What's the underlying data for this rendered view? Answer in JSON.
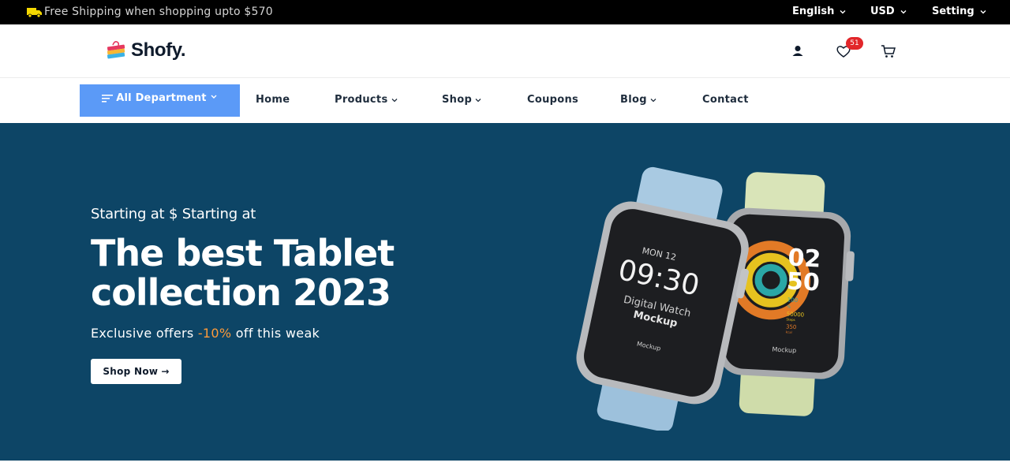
{
  "topbar": {
    "shipping_text": "Free Shipping when shopping upto $570",
    "language": "English",
    "currency": "USD",
    "setting": "Setting"
  },
  "header": {
    "logo_text": "Shofy.",
    "wishlist_count": "51"
  },
  "nav": {
    "department_label": "All Department",
    "links": [
      {
        "label": "Home",
        "has_dropdown": false
      },
      {
        "label": "Products",
        "has_dropdown": true
      },
      {
        "label": "Shop",
        "has_dropdown": true
      },
      {
        "label": "Coupons",
        "has_dropdown": false
      },
      {
        "label": "Blog",
        "has_dropdown": true
      },
      {
        "label": "Contact",
        "has_dropdown": false
      }
    ]
  },
  "hero": {
    "eyebrow": "Starting at $ Starting at",
    "headline_line1": "The best Tablet",
    "headline_line2": "collection 2023",
    "sub_before": "Exclusive offers ",
    "sub_highlight": "-10%",
    "sub_after": " off this weak",
    "cta_label": "Shop Now",
    "cta_arrow": "→",
    "watch1": {
      "date": "MON 12",
      "time": "09:30",
      "line1": "Digital Watch",
      "line2": "Mockup",
      "brand": "Mockup"
    },
    "watch2": {
      "hour": "02",
      "minute": "50",
      "stat1": "100",
      "stat2": "%",
      "stat3": "50000",
      "stat4": "Steps",
      "stat5": "350",
      "stat6": "kcal",
      "brand": "Mockup"
    }
  },
  "colors": {
    "topbar_bg": "#000000",
    "hero_bg": "#0d4566",
    "department_bg": "#5b9af7",
    "highlight": "#fd9a3a",
    "badge": "#e2262a"
  }
}
